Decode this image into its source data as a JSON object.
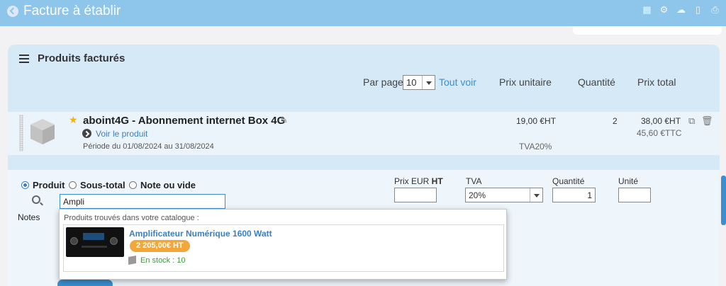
{
  "header": {
    "title": "Facture à établir",
    "icons": [
      "grid-icon",
      "gears-icon",
      "cloud-upload-icon",
      "document-icon",
      "print-icon"
    ]
  },
  "panel": {
    "title": "Produits facturés",
    "per_page_label": "Par page",
    "per_page_value": "10",
    "tout_voir": "Tout voir",
    "columns": {
      "unit_price": "Prix unitaire",
      "quantity": "Quantité",
      "total_price": "Prix total"
    }
  },
  "line_item": {
    "name": "aboint4G - Abonnement internet Box 4G",
    "voir_produit": "Voir le produit",
    "periode": "Période du 01/08/2024 au 31/08/2024",
    "unit_price": "19,00 €HT",
    "tva": "TVA20%",
    "quantity": "2",
    "total_ht": "38,00 €HT",
    "total_ttc": "45,60 €TTC"
  },
  "form": {
    "radios": {
      "produit": "Produit",
      "sous_total": "Sous-total",
      "note": "Note ou vide"
    },
    "search_value": "Ampli",
    "notes_label": "Notes",
    "prix_label_prefix": "Prix EUR ",
    "prix_label_suffix": "HT",
    "tva_label": "TVA",
    "tva_value": "20%",
    "quantite_label": "Quantité",
    "quantite_value": "1",
    "unite_label": "Unité"
  },
  "dropdown": {
    "title": "Produits trouvés dans votre catalogue :",
    "items": [
      {
        "name": "Amplificateur Numérique 1600 Watt",
        "price": "2 205,00€ HT",
        "stock": "En stock : 10"
      }
    ]
  },
  "colors": {
    "header_bg": "#8ec5ea",
    "panel_bg": "#d5e9f7",
    "accent": "#3a8fd0",
    "price_badge": "#f2a73a",
    "stock_green": "#3e9a3e"
  }
}
